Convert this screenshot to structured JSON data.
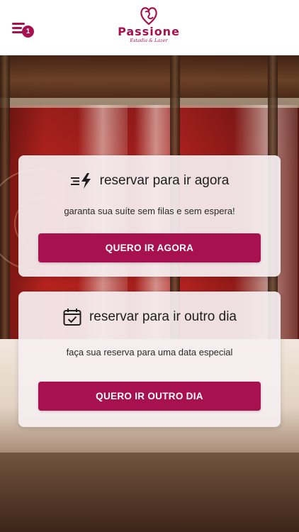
{
  "header": {
    "menu_icon": "hamburger-menu-icon",
    "badge_count": "1",
    "logo_name": "Passione",
    "logo_tagline": "Estadia & Lazer",
    "brand_color": "#a8114f"
  },
  "cards": {
    "now": {
      "icon": "fast-lightning-icon",
      "title": "reservar para ir agora",
      "subtitle": "garanta sua suíte sem filas e sem espera!",
      "button_label": "QUERO IR AGORA"
    },
    "later": {
      "icon": "calendar-check-icon",
      "title": "reservar para ir outro dia",
      "subtitle": "faça sua reserva para uma data especial",
      "button_label": "QUERO IR OUTRO DIA"
    }
  }
}
